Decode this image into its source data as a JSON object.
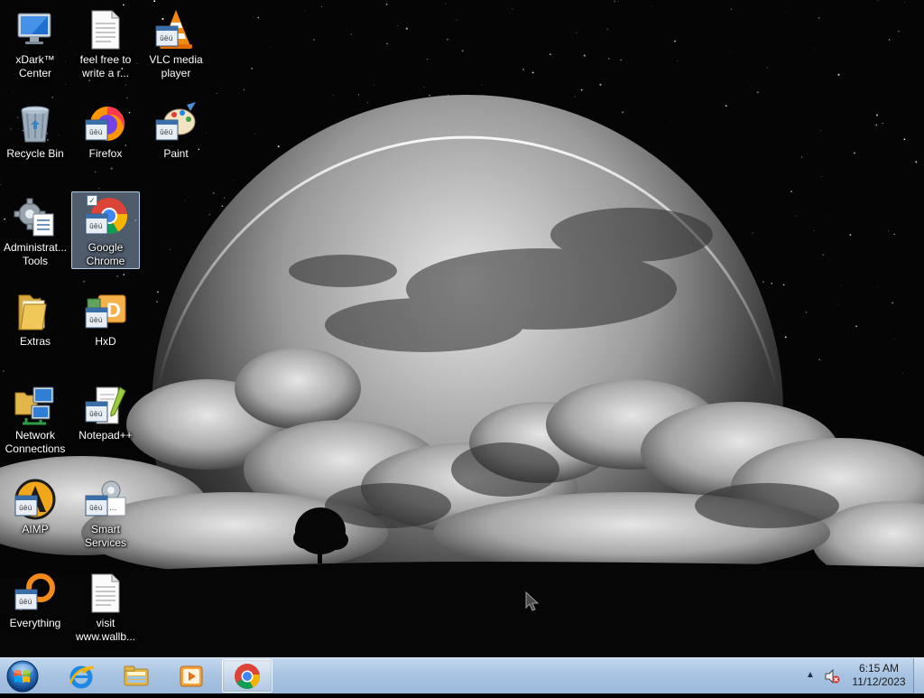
{
  "desktop": {
    "icons": [
      {
        "id": "xdark",
        "label": "xDark™\nCenter",
        "icon": "monitor-icon"
      },
      {
        "id": "feel-free",
        "label": "feel free to\nwrite a r...",
        "icon": "text-document-icon"
      },
      {
        "id": "vlc",
        "label": "VLC media\nplayer",
        "icon": "vlc-cone-icon"
      },
      {
        "id": "recycle-bin",
        "label": "Recycle Bin",
        "icon": "recycle-bin-icon"
      },
      {
        "id": "firefox",
        "label": "Firefox",
        "icon": "firefox-icon"
      },
      {
        "id": "paint",
        "label": "Paint",
        "icon": "paint-palette-icon"
      },
      {
        "id": "admin-tools",
        "label": "Administrat...\nTools",
        "icon": "gear-document-icon"
      },
      {
        "id": "chrome",
        "label": "Google\nChrome",
        "icon": "chrome-icon",
        "selected": true
      },
      {
        "id": "extras",
        "label": "Extras",
        "icon": "folder-icon"
      },
      {
        "id": "hxd",
        "label": "HxD",
        "icon": "hex-editor-icon"
      },
      {
        "id": "network",
        "label": "Network\nConnections",
        "icon": "network-icon"
      },
      {
        "id": "notepadpp",
        "label": "Notepad++",
        "icon": "notepad-plus-plus-icon"
      },
      {
        "id": "aimp",
        "label": "AIMP",
        "icon": "aimp-icon"
      },
      {
        "id": "smart-services",
        "label": "Smart\nServices",
        "icon": "services-gear-icon"
      },
      {
        "id": "everything",
        "label": "Everything",
        "icon": "everything-search-icon"
      },
      {
        "id": "visit",
        "label": "visit\nwww.wallb...",
        "icon": "text-document-icon"
      }
    ]
  },
  "taskbar": {
    "start_icon": "windows-start-orb-icon",
    "pinned": [
      {
        "id": "ie",
        "icon": "internet-explorer-icon"
      },
      {
        "id": "explorer",
        "icon": "file-explorer-icon"
      },
      {
        "id": "media",
        "icon": "media-player-icon"
      },
      {
        "id": "chrome",
        "icon": "chrome-icon",
        "active": true
      }
    ],
    "tray": {
      "overflow_arrow": "▲",
      "volume_icon": "volume-muted-icon",
      "time": "6:15 AM",
      "date": "11/12/2023"
    }
  },
  "colors": {
    "taskbar_top": "#c3d8ee",
    "taskbar_bottom": "#9bb9db",
    "selection": "#aac8eb"
  }
}
